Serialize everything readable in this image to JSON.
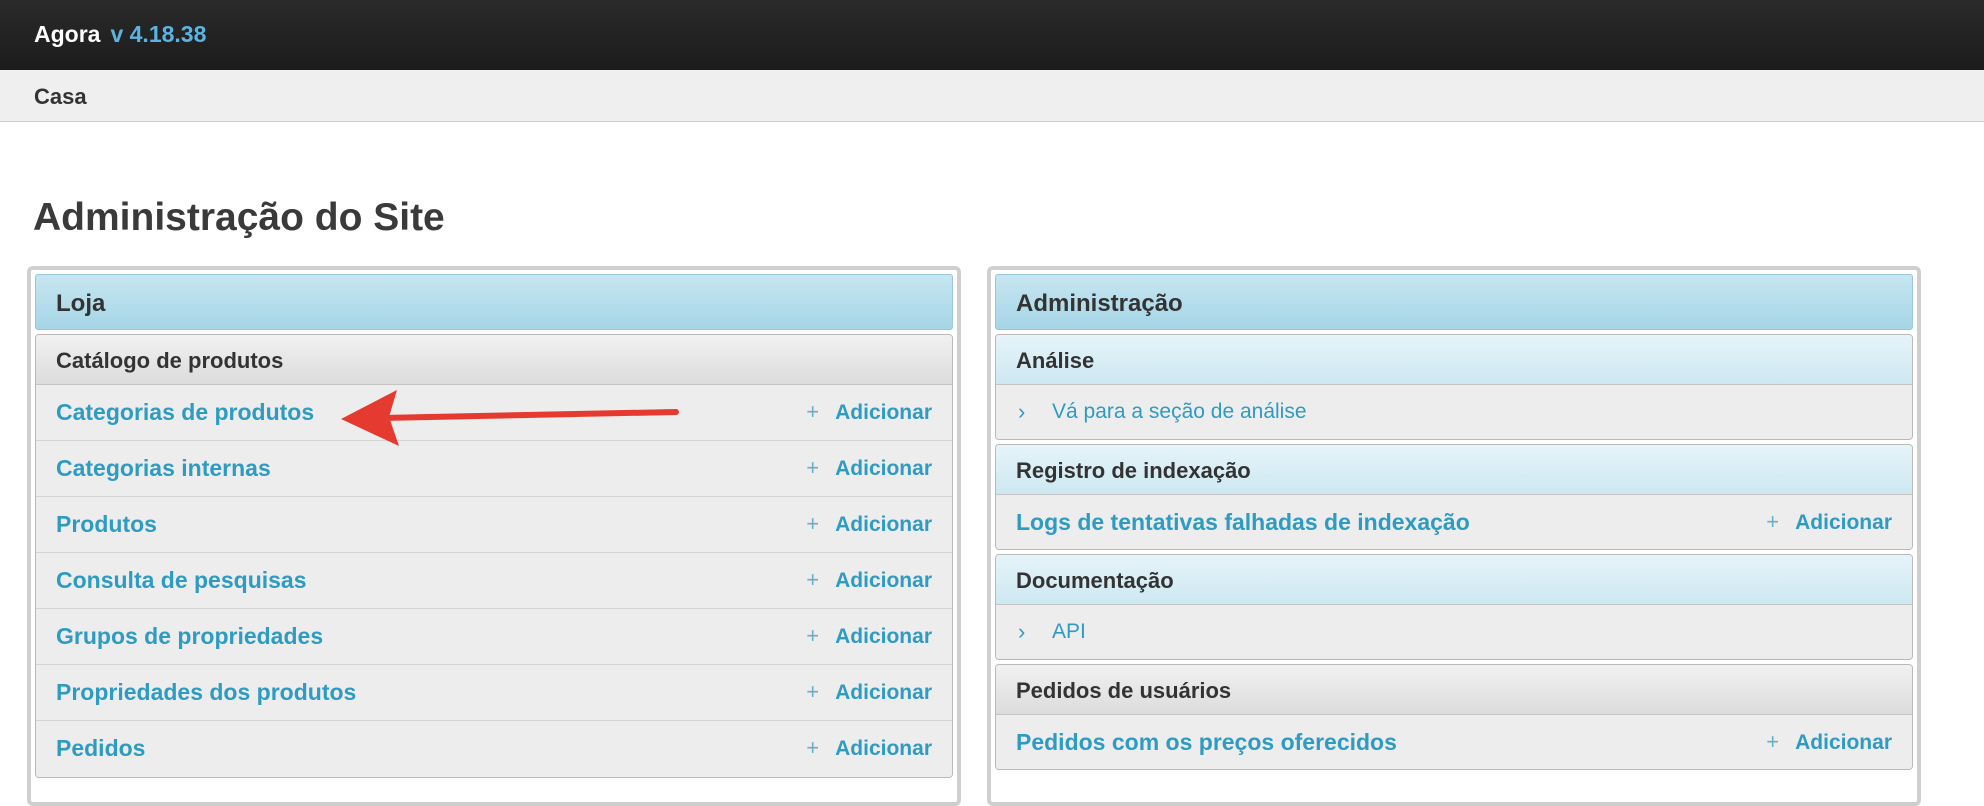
{
  "app": {
    "name": "Agora",
    "version": "v 4.18.38"
  },
  "breadcrumb": "Casa",
  "page_title": "Administração do Site",
  "left_panel": {
    "title": "Loja",
    "section": "Catálogo de produtos",
    "add_label": "Adicionar",
    "items": [
      "Categorias de produtos",
      "Categorias internas",
      "Produtos",
      "Consulta de pesquisas",
      "Grupos de propriedades",
      "Propriedades dos produtos",
      "Pedidos"
    ]
  },
  "right_panel": {
    "title": "Administração",
    "add_label": "Adicionar",
    "sections": {
      "analise": {
        "title": "Análise",
        "link": "Vá para a seção de análise"
      },
      "indexacao": {
        "title": "Registro de indexação",
        "item": "Logs de tentativas falhadas de indexação"
      },
      "documentacao": {
        "title": "Documentação",
        "link": "API"
      },
      "pedidos": {
        "title": "Pedidos de usuários",
        "item": "Pedidos com os preços oferecidos"
      }
    }
  },
  "icons": {
    "add": "plus-icon",
    "chevron": "chevron-right-icon",
    "annotation": "red-arrow"
  },
  "colors": {
    "link": "#2e9bc2",
    "topbar": "#1c1c1c",
    "version": "#5bb4e0",
    "arrow": "#e53a30"
  }
}
